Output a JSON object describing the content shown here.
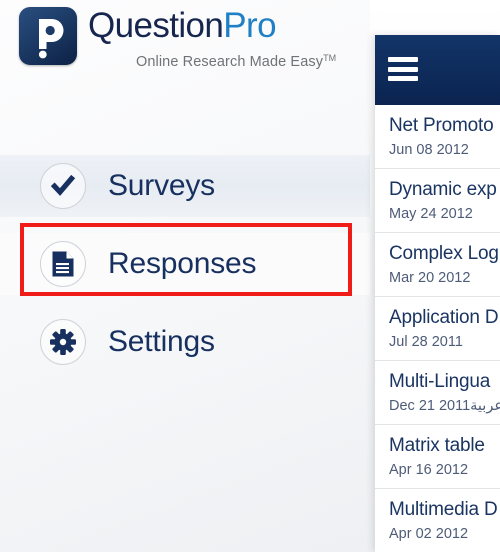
{
  "brand": {
    "logo_icon": "questionpro-p-logo-icon",
    "name_part1": "Question",
    "name_part2": "Pro",
    "tagline": "Online Research Made Easy",
    "tagline_mark": "TM"
  },
  "nav": {
    "items": [
      {
        "id": "surveys",
        "label": "Surveys",
        "icon": "check-circle-icon",
        "selected": false
      },
      {
        "id": "responses",
        "label": "Responses",
        "icon": "document-icon",
        "selected": true
      },
      {
        "id": "settings",
        "label": "Settings",
        "icon": "gear-icon",
        "selected": false
      }
    ]
  },
  "highlight": {
    "color": "#ef1c18",
    "target": "responses"
  },
  "right_panel": {
    "header": {
      "menu_icon": "hamburger-menu-icon"
    },
    "list": [
      {
        "title": "Net Promoto",
        "date": "Jun 08 2012"
      },
      {
        "title": "Dynamic exp",
        "date": "May 24 2012"
      },
      {
        "title": "Complex Log",
        "date": "Mar 20 2012"
      },
      {
        "title": "Application D",
        "date": "Jul 28 2011"
      },
      {
        "title": "Multi-Lingua",
        "date": "Dec 21 2011عربية"
      },
      {
        "title": "Matrix table",
        "date": "Apr 16 2012"
      },
      {
        "title": "Multimedia D",
        "date": "Apr 02 2012"
      }
    ]
  },
  "colors": {
    "brand_dark": "#17264f",
    "brand_blue": "#2080c6",
    "nav_text": "#17305f",
    "panel_header": "#0e2c5c",
    "highlight_red": "#ef1c18",
    "list_title": "#1b3563",
    "list_date": "#4e5c78"
  }
}
